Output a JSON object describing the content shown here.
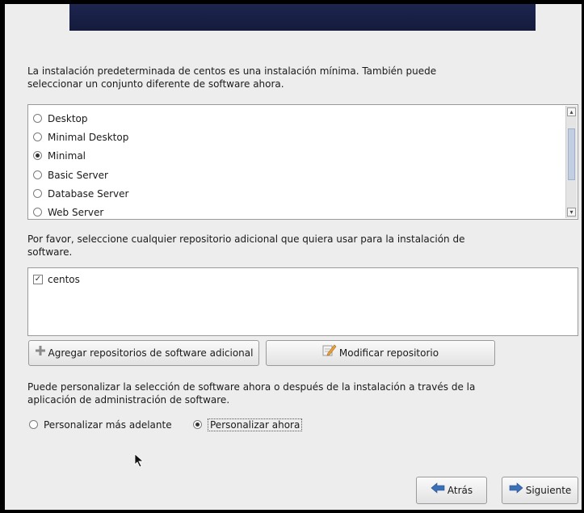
{
  "intro_text": "La instalación predeterminada de centos es una instalación mínima. También puede seleccionar un conjunto diferente de software ahora.",
  "environments": [
    {
      "label": "Desktop",
      "selected": false
    },
    {
      "label": "Minimal Desktop",
      "selected": false
    },
    {
      "label": "Minimal",
      "selected": true
    },
    {
      "label": "Basic Server",
      "selected": false
    },
    {
      "label": "Database Server",
      "selected": false
    },
    {
      "label": "Web Server",
      "selected": false
    }
  ],
  "repo_intro_text": "Por favor, seleccione cualquier repositorio adicional que quiera usar para la instalación de software.",
  "repositories": [
    {
      "label": "centos",
      "checked": true
    }
  ],
  "buttons": {
    "add_repo": "Agregar repositorios de software adicional",
    "modify_repo": "Modificar repositorio",
    "back": "Atrás",
    "next": "Siguiente"
  },
  "customize_text": "Puede personalizar la selección de software ahora o después de la instalación a través de la aplicación de administración de software.",
  "customize_options": {
    "later": "Personalizar más adelante",
    "now": "Personalizar ahora",
    "selected": "now"
  },
  "colors": {
    "banner": "#1d2550",
    "panel": "#ededed",
    "scroll_thumb": "#c2cfe3"
  },
  "icons": {
    "add_repo": "plus-icon",
    "modify_repo": "edit-icon",
    "back": "arrow-left-icon",
    "next": "arrow-right-icon"
  }
}
